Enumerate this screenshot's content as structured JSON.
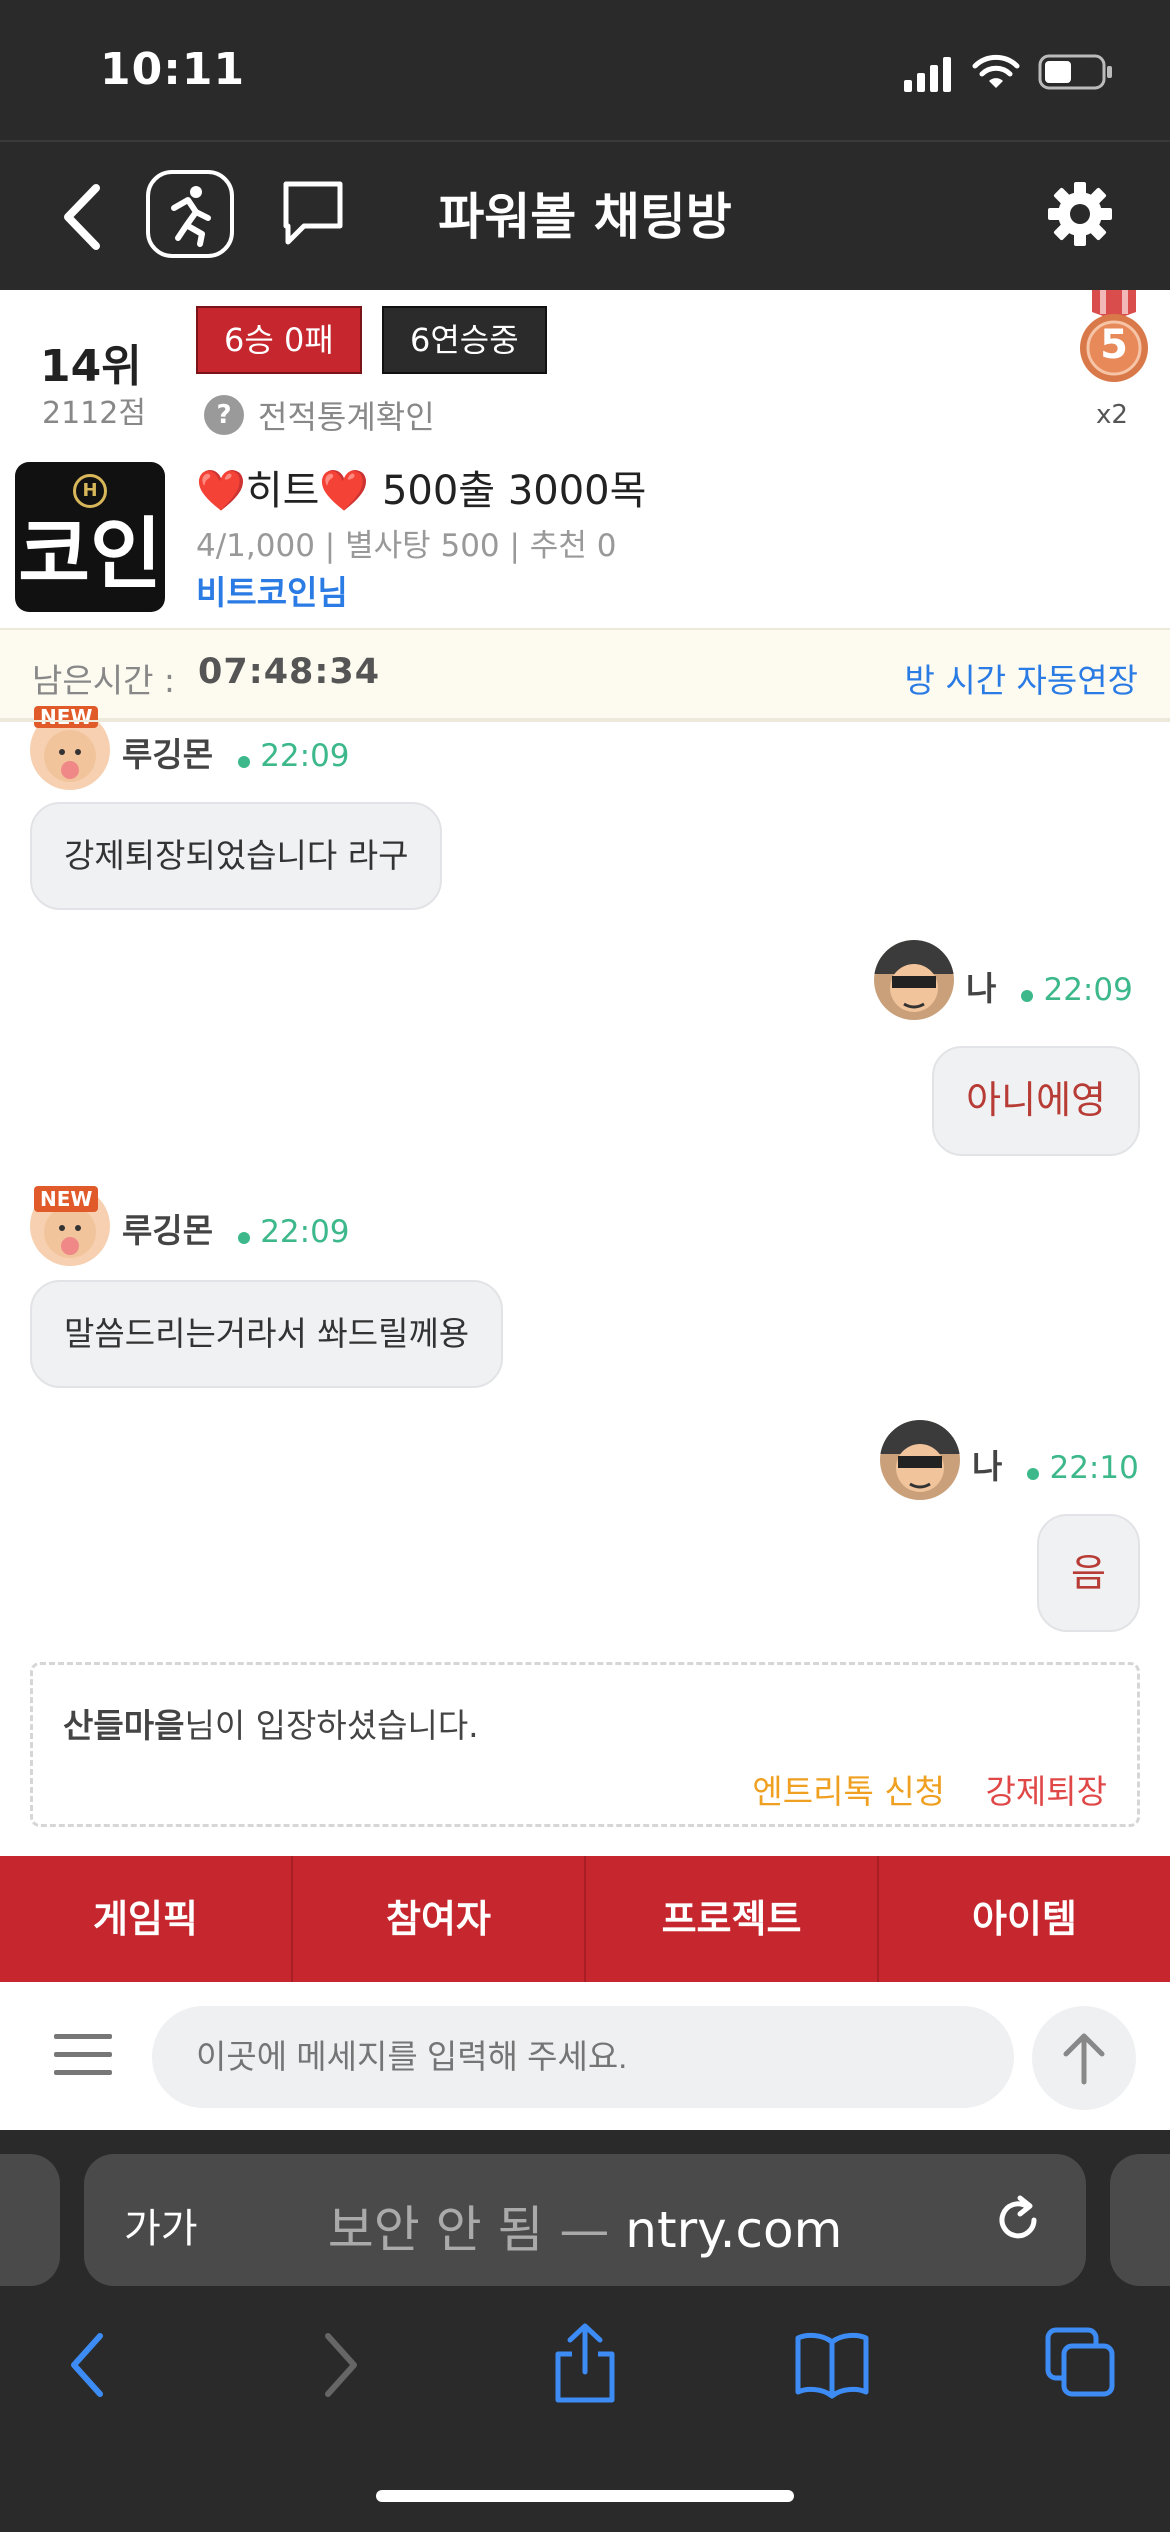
{
  "status_bar": {
    "time": "10:11"
  },
  "nav": {
    "title": "파워볼 채팅방"
  },
  "room": {
    "rank": "14위",
    "score": "2112점",
    "wins_badge": "6승 0패",
    "streak_badge": "6연승중",
    "stats_link": "전적통계확인",
    "medal_level": "5",
    "medal_multiplier": "x2",
    "logo_text": "코인",
    "logo_mark": "H",
    "name_heart_left": "❤️",
    "name_text": "히트",
    "name_heart_right": "❤️",
    "name_suffix": "500출 3000목",
    "info": "4/1,000 | 별사탕 500 | 추천 0",
    "host": "비트코인님"
  },
  "timer": {
    "label": "남은시간 :",
    "value": "07:48:34",
    "extend": "방 시간 자동연장"
  },
  "messages": [
    {
      "user": "루깅몬",
      "time": "22:09",
      "text": "강제퇴장되었습니다 라구",
      "badge": "NEW"
    },
    {
      "user": "나",
      "time": "22:09",
      "text": "아니에영"
    },
    {
      "user": "루깅몬",
      "time": "22:09",
      "text": "말씀드리는거라서 쏴드릴께용",
      "badge": "NEW"
    },
    {
      "user": "나",
      "time": "22:10",
      "text": "음"
    }
  ],
  "notice": {
    "user": "산들마을",
    "text": "님이 입장하셨습니다.",
    "action_entry": "엔트리톡 신청",
    "action_kick": "강제퇴장",
    "entry_color": "#f0a020",
    "kick_color": "#e04848"
  },
  "tabs": [
    "게임픽",
    "참여자",
    "프로젝트",
    "아이템"
  ],
  "input": {
    "placeholder": "이곳에 메세지를 입력해 주세요."
  },
  "safari": {
    "aa": "가가",
    "insecure": "보안 안 됨 —",
    "domain": "ntry.com"
  },
  "icons": [
    "back-icon",
    "running-man-icon",
    "chat-bubble-icon",
    "gear-icon",
    "signal-icon",
    "wifi-icon",
    "battery-icon",
    "menu-icon",
    "arrow-up-icon",
    "reload-icon",
    "share-icon",
    "bookmarks-icon",
    "tabs-icon"
  ]
}
